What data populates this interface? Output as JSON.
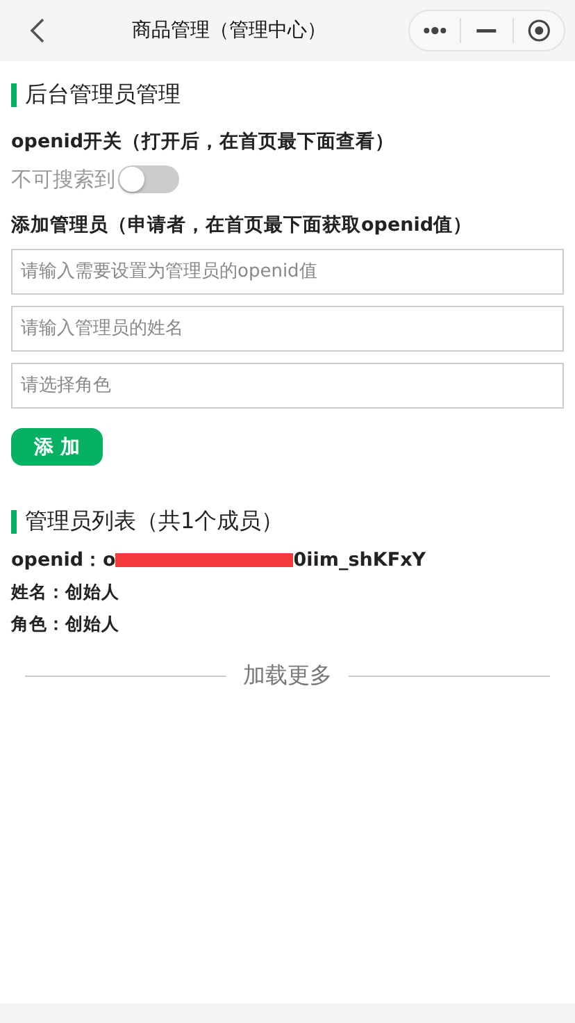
{
  "nav_bar": {
    "title": "商品管理（管理中心）"
  },
  "admin_section": {
    "title": "后台管理员管理",
    "openid_switch": {
      "label": "openid开关（打开后，在首页最下面查看）",
      "text": "不可搜索到",
      "on": false
    },
    "add_admin": {
      "label": "添加管理员（申请者，在首页最下面获取openid值）",
      "fields": [
        {
          "placeholder": "请输入需要设置为管理员的openid值"
        },
        {
          "placeholder": "请输入管理员的姓名"
        },
        {
          "placeholder": "请选择角色"
        }
      ],
      "button": "添 加"
    }
  },
  "admin_list": {
    "title": "管理员列表（共1个成员）",
    "members": [
      {
        "openid_start": "openid：o",
        "redacted": true,
        "openid_end": "0iim_shKFxY",
        "name": "姓名：创始人",
        "role": "角色：创始人"
      }
    ]
  },
  "load_more": "加载更多"
}
